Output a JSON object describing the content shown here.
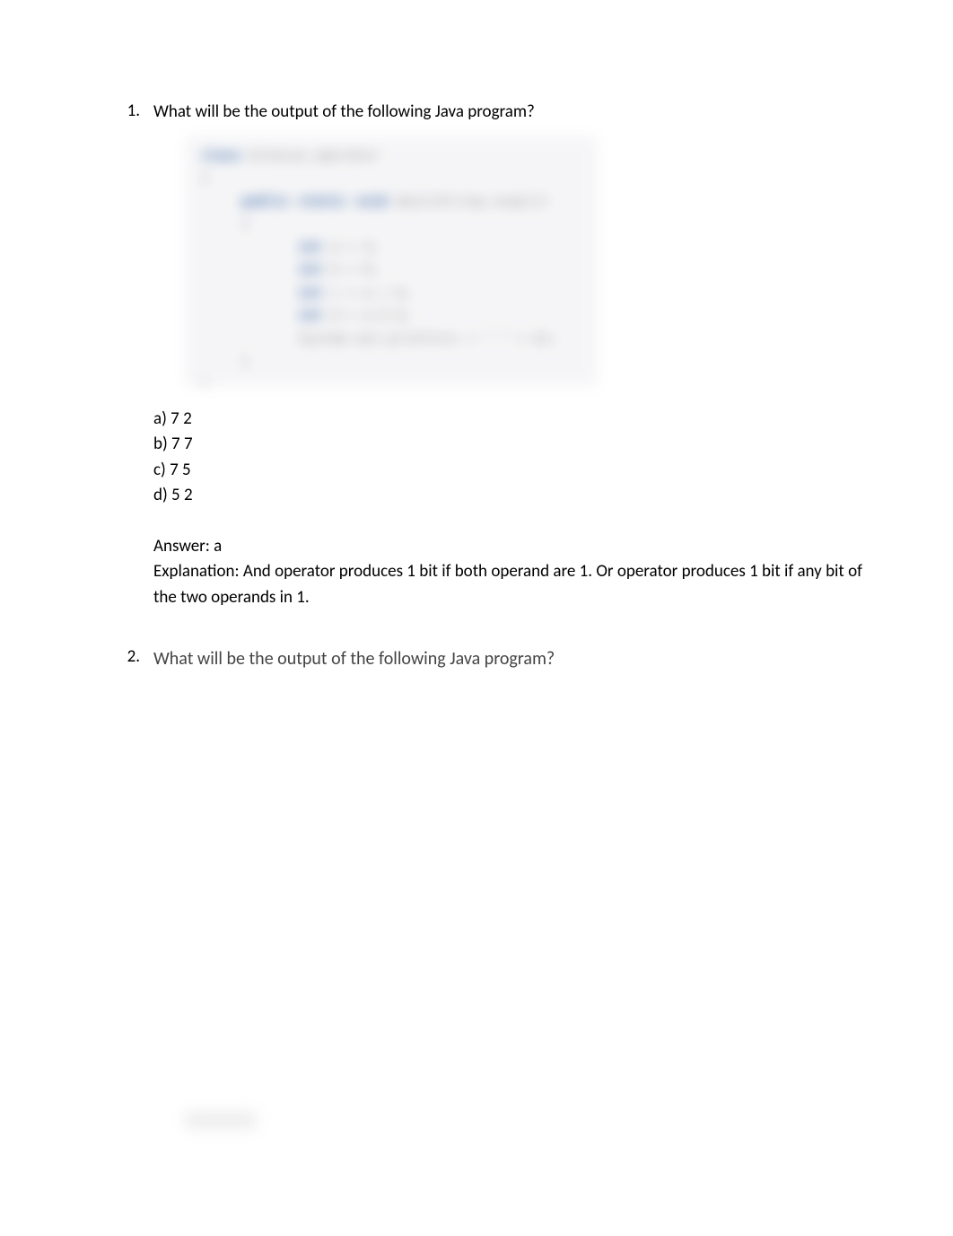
{
  "q1": {
    "number": "1.",
    "prompt": "What will be the output of the following Java program?",
    "options": {
      "a": "a) 7 2",
      "b": "b) 7 7",
      "c": "c) 7 5",
      "d": "d) 5 2"
    },
    "answer_label": "Answer: a",
    "explanation": "Explanation: And operator produces 1 bit if both operand are 1. Or operator produces 1 bit if any bit of the two operands in 1."
  },
  "q2": {
    "number": "2.",
    "prompt": "What will be the output of the following Java program?"
  }
}
